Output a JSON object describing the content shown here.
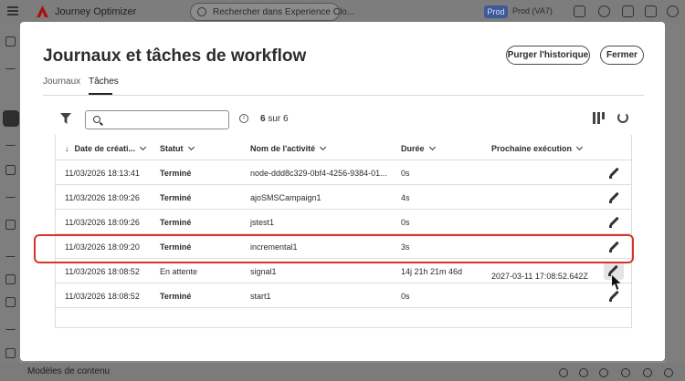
{
  "app": {
    "name": "Journey Optimizer",
    "search_placeholder": "Rechercher dans Experience Clo...",
    "env_badge": "Prod",
    "env_label": "Prod (VA7)"
  },
  "bottom_bar": {
    "label": "Modèles de contenu"
  },
  "modal": {
    "title": "Journaux et tâches de workflow",
    "purge_button": "Purger l'historique",
    "close_button": "Fermer",
    "tabs": [
      {
        "label": "Journaux",
        "active": false
      },
      {
        "label": "Tâches",
        "active": true
      }
    ],
    "search": {
      "value": ""
    },
    "result_count": {
      "shown": "6",
      "text": "sur 6"
    },
    "columns": {
      "created": "Date de créati...",
      "status": "Statut",
      "activity": "Nom de l'activité",
      "duration": "Durée",
      "next_run": "Prochaine exécution"
    },
    "rows": [
      {
        "created": "11/03/2026 18:13:41",
        "status": "Terminé",
        "activity": "node-ddd8c329-0bf4-4256-9384-01...",
        "duration": "0s",
        "next_run": ""
      },
      {
        "created": "11/03/2026 18:09:26",
        "status": "Terminé",
        "activity": "ajoSMSCampaign1",
        "duration": "4s",
        "next_run": ""
      },
      {
        "created": "11/03/2026 18:09:26",
        "status": "Terminé",
        "activity": "jstest1",
        "duration": "0s",
        "next_run": ""
      },
      {
        "created": "11/03/2026 18:09:20",
        "status": "Terminé",
        "activity": "incremental1",
        "duration": "3s",
        "next_run": ""
      },
      {
        "created": "11/03/2026 18:08:52",
        "status": "En attente",
        "activity": "signal1",
        "duration": "14j 21h 21m 46d",
        "next_run": "2027-03-11 17:08:52.642Z"
      },
      {
        "created": "11/03/2026 18:08:52",
        "status": "Terminé",
        "activity": "start1",
        "duration": "0s",
        "next_run": ""
      }
    ]
  },
  "colors": {
    "highlight": "#d9342b",
    "overlay": "#8a8a8a",
    "accent": "#2c2c2c"
  }
}
